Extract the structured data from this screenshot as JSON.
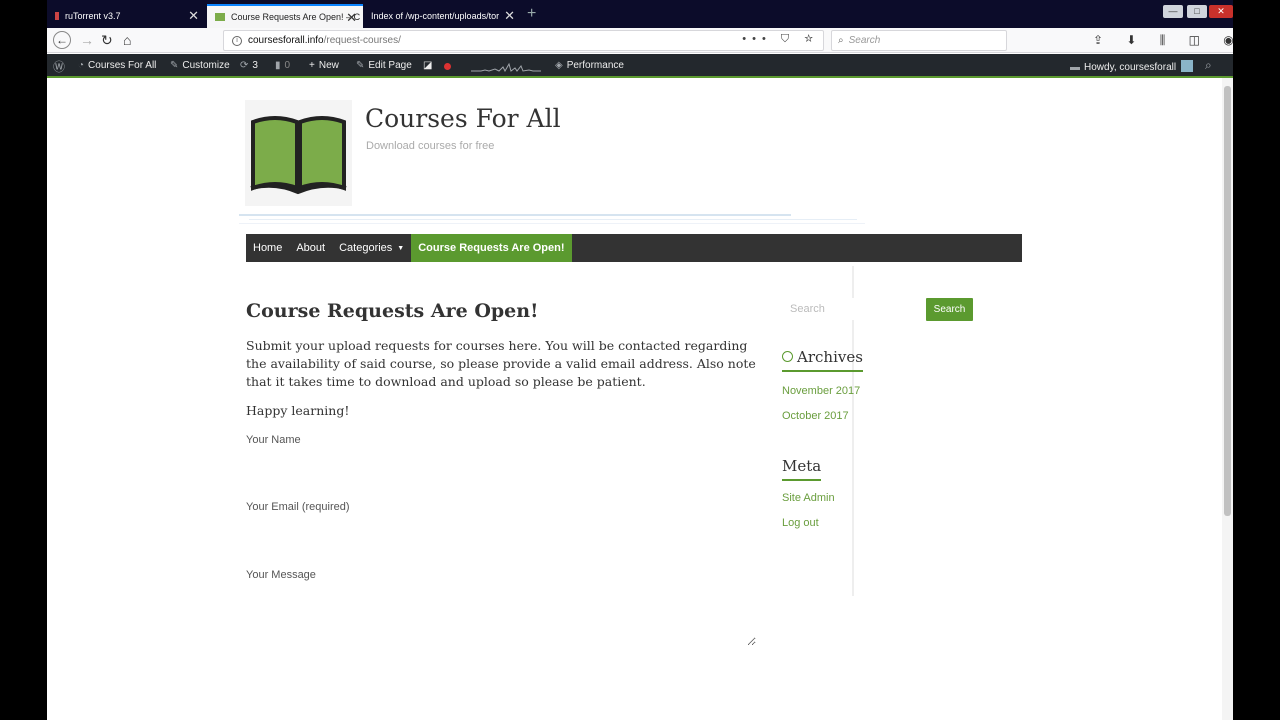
{
  "browser": {
    "tabs": [
      {
        "title": "ruTorrent v3.7",
        "active": false
      },
      {
        "title": "Course Requests Are Open! – C",
        "active": true
      },
      {
        "title": "Index of /wp-content/uploads/tor",
        "active": false
      }
    ],
    "tab_close_glyph": "✕",
    "new_tab_glyph": "+",
    "window_controls": {
      "minimize": "—",
      "maximize": "□",
      "close": "✕"
    },
    "url_host": "coursesforall.info",
    "url_path": "/request-courses/",
    "url_icons": "••• ⛉ ☆",
    "search_placeholder": "Search",
    "toolbar_icons": "⇪ ⬇ ⫼ ◫ ◉ ≡"
  },
  "admin_bar": {
    "site_name": "Courses For All",
    "customize": "Customize",
    "updates_count": "3",
    "comments_count": "0",
    "new": "New",
    "edit_page": "Edit Page",
    "performance": "Performance",
    "howdy": "Howdy, coursesforall"
  },
  "site": {
    "title": "Courses For All",
    "tagline": "Download courses for free",
    "accent_color": "#5b9a2f",
    "logo_color": "#7cac4a"
  },
  "nav": {
    "items": [
      "Home",
      "About",
      "Categories",
      "Course Requests Are Open!"
    ],
    "active_index": 3
  },
  "post": {
    "title": "Course Requests Are Open!",
    "body": "Submit your upload requests for courses here. You will be contacted regarding the availability of said course, so please provide a valid email address. Also note that it takes time to download and upload so please be patient.",
    "closing": "Happy learning!"
  },
  "form": {
    "name_label": "Your Name",
    "email_label": "Your Email (required)",
    "message_label": "Your Message"
  },
  "sidebar": {
    "search_placeholder": "Search",
    "search_button": "Search",
    "archives_title": "Archives",
    "archives": [
      "November 2017",
      "October 2017"
    ],
    "meta_title": "Meta",
    "meta_links": [
      "Site Admin",
      "Log out"
    ]
  }
}
